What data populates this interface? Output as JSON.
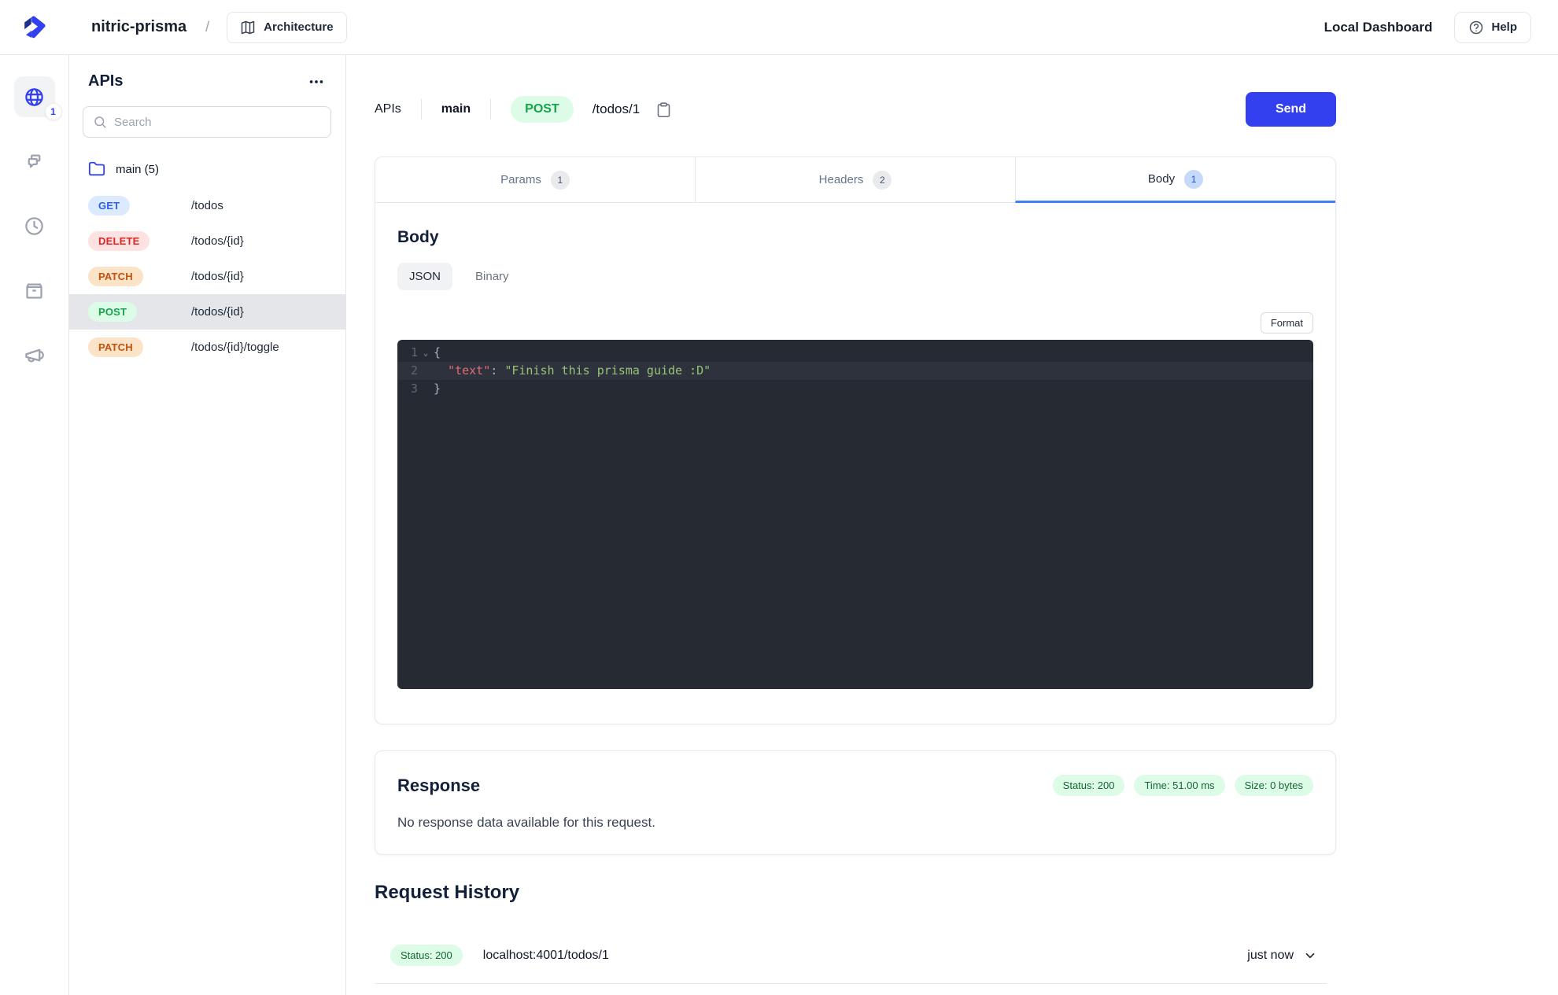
{
  "colors": {
    "accent_blue": "#3240f0",
    "tab_active_underline": "#3b82f6",
    "success_green_bg": "#dcfce7",
    "success_green_text": "#166534",
    "editor_bg": "#262b33"
  },
  "topbar": {
    "project_name": "nitric-prisma",
    "breadcrumb_separator": "/",
    "architecture_button": "Architecture",
    "dashboard_title": "Local Dashboard",
    "help_button": "Help"
  },
  "rail": {
    "apis_badge": "1"
  },
  "sidebar": {
    "title": "APIs",
    "search_placeholder": "Search",
    "group_label": "main (5)",
    "endpoints": [
      {
        "method": "GET",
        "path": "/todos",
        "selected": false
      },
      {
        "method": "DELETE",
        "path": "/todos/{id}",
        "selected": false
      },
      {
        "method": "PATCH",
        "path": "/todos/{id}",
        "selected": false
      },
      {
        "method": "POST",
        "path": "/todos/{id}",
        "selected": true
      },
      {
        "method": "PATCH",
        "path": "/todos/{id}/toggle",
        "selected": false
      }
    ]
  },
  "request": {
    "breadcrumb": {
      "root": "APIs",
      "api": "main",
      "method": "POST",
      "path": "/todos/1"
    },
    "send_label": "Send",
    "tabs": [
      {
        "label": "Params",
        "badge": "1",
        "active": false
      },
      {
        "label": "Headers",
        "badge": "2",
        "active": false
      },
      {
        "label": "Body",
        "badge": "1",
        "active": true
      }
    ],
    "body": {
      "title": "Body",
      "mode_json": "JSON",
      "mode_binary": "Binary",
      "active_mode": "JSON",
      "format_label": "Format",
      "code_lines": [
        {
          "num": "1",
          "fold": true,
          "active": false,
          "tokens": [
            {
              "text": "{",
              "cls": "p"
            }
          ]
        },
        {
          "num": "2",
          "fold": false,
          "active": true,
          "tokens": [
            {
              "text": "  ",
              "cls": "p"
            },
            {
              "text": "\"text\"",
              "cls": "key"
            },
            {
              "text": ": ",
              "cls": "p"
            },
            {
              "text": "\"Finish this prisma guide :D\"",
              "cls": "str"
            }
          ]
        },
        {
          "num": "3",
          "fold": false,
          "active": false,
          "tokens": [
            {
              "text": "}",
              "cls": "p"
            }
          ]
        }
      ]
    }
  },
  "response": {
    "title": "Response",
    "badges": [
      {
        "label": "Status: 200"
      },
      {
        "label": "Time: 51.00 ms"
      },
      {
        "label": "Size: 0 bytes"
      }
    ],
    "empty_message": "No response data available for this request."
  },
  "history": {
    "title": "Request History",
    "rows": [
      {
        "status": "Status: 200",
        "url": "localhost:4001/todos/1",
        "time": "just now"
      }
    ]
  }
}
